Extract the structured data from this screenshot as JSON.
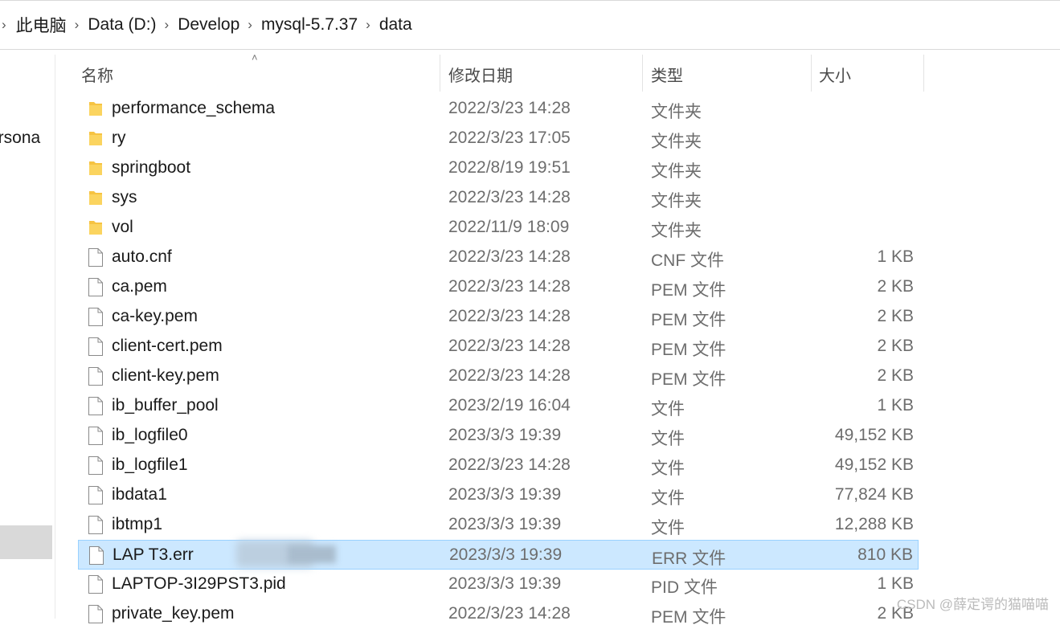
{
  "breadcrumb": [
    "此电脑",
    "Data (D:)",
    "Develop",
    "mysql-5.7.37",
    "data"
  ],
  "nav": {
    "items": [
      {
        "label": "ersona"
      },
      {
        "label": ":)"
      }
    ]
  },
  "columns": {
    "name": "名称",
    "date": "修改日期",
    "type": "类型",
    "size": "大小"
  },
  "files": [
    {
      "name": "performance_schema",
      "date": "2022/3/23 14:28",
      "type": "文件夹",
      "size": "",
      "icon": "folder-icon"
    },
    {
      "name": "ry",
      "date": "2022/3/23 17:05",
      "type": "文件夹",
      "size": "",
      "icon": "folder-icon"
    },
    {
      "name": "springboot",
      "date": "2022/8/19 19:51",
      "type": "文件夹",
      "size": "",
      "icon": "folder-icon"
    },
    {
      "name": "sys",
      "date": "2022/3/23 14:28",
      "type": "文件夹",
      "size": "",
      "icon": "folder-icon"
    },
    {
      "name": "vol",
      "date": "2022/11/9 18:09",
      "type": "文件夹",
      "size": "",
      "icon": "folder-icon"
    },
    {
      "name": "auto.cnf",
      "date": "2022/3/23 14:28",
      "type": "CNF 文件",
      "size": "1 KB",
      "icon": "file-icon"
    },
    {
      "name": "ca.pem",
      "date": "2022/3/23 14:28",
      "type": "PEM 文件",
      "size": "2 KB",
      "icon": "file-icon"
    },
    {
      "name": "ca-key.pem",
      "date": "2022/3/23 14:28",
      "type": "PEM 文件",
      "size": "2 KB",
      "icon": "file-icon"
    },
    {
      "name": "client-cert.pem",
      "date": "2022/3/23 14:28",
      "type": "PEM 文件",
      "size": "2 KB",
      "icon": "file-icon"
    },
    {
      "name": "client-key.pem",
      "date": "2022/3/23 14:28",
      "type": "PEM 文件",
      "size": "2 KB",
      "icon": "file-icon"
    },
    {
      "name": "ib_buffer_pool",
      "date": "2023/2/19 16:04",
      "type": "文件",
      "size": "1 KB",
      "icon": "file-icon"
    },
    {
      "name": "ib_logfile0",
      "date": "2023/3/3 19:39",
      "type": "文件",
      "size": "49,152 KB",
      "icon": "file-icon"
    },
    {
      "name": "ib_logfile1",
      "date": "2022/3/23 14:28",
      "type": "文件",
      "size": "49,152 KB",
      "icon": "file-icon"
    },
    {
      "name": "ibdata1",
      "date": "2023/3/3 19:39",
      "type": "文件",
      "size": "77,824 KB",
      "icon": "file-icon"
    },
    {
      "name": "ibtmp1",
      "date": "2023/3/3 19:39",
      "type": "文件",
      "size": "12,288 KB",
      "icon": "file-icon"
    },
    {
      "name": "LAP          T3.err",
      "date": "2023/3/3 19:39",
      "type": "ERR 文件",
      "size": "810 KB",
      "icon": "file-icon",
      "selected": true,
      "redacted": true
    },
    {
      "name": "LAPTOP-3I29PST3.pid",
      "date": "2023/3/3 19:39",
      "type": "PID 文件",
      "size": "1 KB",
      "icon": "file-icon"
    },
    {
      "name": "private_key.pem",
      "date": "2022/3/23 14:28",
      "type": "PEM 文件",
      "size": "2 KB",
      "icon": "file-icon"
    }
  ],
  "watermark": "CSDN @薛定谔的猫喵喵",
  "colors": {
    "selected_bg": "#cce8ff",
    "selected_border": "#99d1ff",
    "folder": "#f6c342",
    "muted_text": "#6d6d6d"
  }
}
